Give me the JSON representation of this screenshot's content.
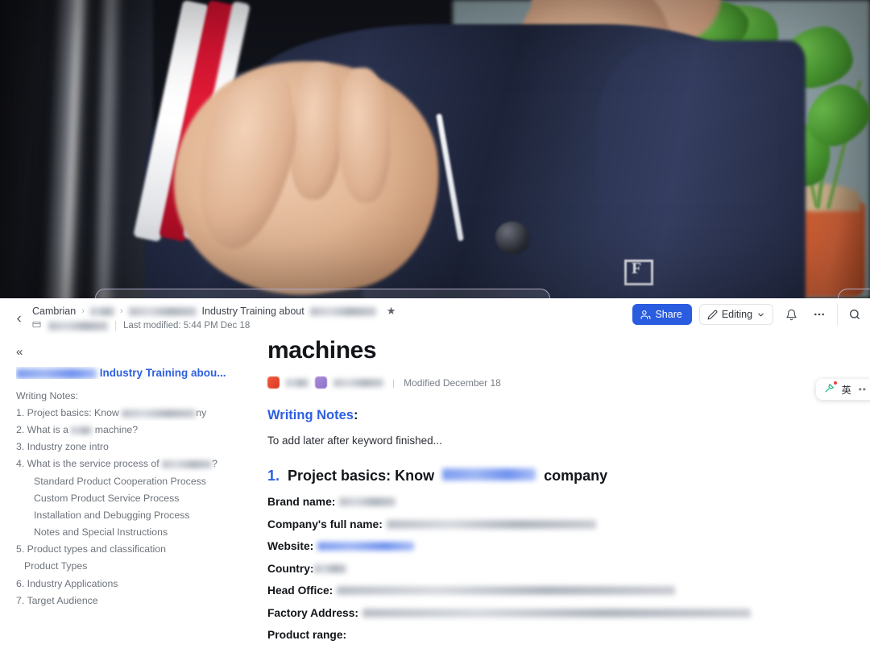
{
  "video": {
    "description": "webcam-video-person-in-navy-jacket",
    "brand_logo": "FILA",
    "window_lip": "rounded-window-edge"
  },
  "topbar": {
    "back_icon": "chevron-left-icon",
    "breadcrumb": {
      "root": "Cambrian",
      "sep": "›",
      "crumb2_redacted": "",
      "crumb3_redacted": "",
      "title_text": "Industry Training about",
      "title_suffix_redacted": "",
      "star_icon": "★"
    },
    "doc_chip_icon": "document-icon",
    "doc_chip_redacted": "",
    "last_modified": "Last modified: 5:44 PM Dec 18",
    "share_label": "Share",
    "share_icon": "people-icon",
    "share_color": "#2a5ce0",
    "editing_label": "Editing",
    "editing_icon": "pencil-icon",
    "editing_caret": "chevron-down-icon",
    "bell_icon": "bell-icon",
    "more_icon": "ellipsis-icon",
    "search_icon": "search-icon",
    "plus_icon": "plus-icon"
  },
  "sidebar": {
    "collapse_icon": "«",
    "outline_title_redacted": "",
    "outline_title": "Industry Training abou...",
    "items": [
      {
        "label": "Writing Notes:",
        "level": 1
      },
      {
        "label": "1. Project basics: Know",
        "level": 1,
        "redacted_tail": "ny"
      },
      {
        "label": "2. What is a",
        "level": 1,
        "redacted_mid": "machine?"
      },
      {
        "label": "3. Industry zone intro",
        "level": 1
      },
      {
        "label": "4. What is the service process of",
        "level": 1,
        "redacted_tail": "?"
      },
      {
        "label": "Standard Product Cooperation Process",
        "level": 2
      },
      {
        "label": "Custom Product Service Process",
        "level": 2
      },
      {
        "label": "Installation and Debugging Process",
        "level": 2
      },
      {
        "label": "Notes and Special Instructions",
        "level": 2
      },
      {
        "label": "5. Product types and classification",
        "level": 1
      },
      {
        "label": "Product Types",
        "level": 1.5
      },
      {
        "label": "6. Industry Applications",
        "level": 1
      },
      {
        "label": "7. Target Audience",
        "level": 1
      }
    ]
  },
  "content": {
    "doc_title": "machines",
    "meta": {
      "author1_redacted": "",
      "author2_redacted": "",
      "modified": "Modified December 18"
    },
    "writing_notes_heading": "Writing Notes",
    "writing_notes_colon": ":",
    "writing_notes_body": "To add later after keyword finished...",
    "section1": {
      "number": "1.",
      "text_before": "Project basics: Know",
      "redacted": "",
      "text_after": "company"
    },
    "fields": [
      {
        "label": "Brand name:",
        "value_redacted": "",
        "value_width": 70,
        "value_type": "gray"
      },
      {
        "label": "Company's full name",
        "label_suffix": ":",
        "value_redacted": "",
        "value_width": 260,
        "value_type": "gray"
      },
      {
        "label": "Website:",
        "value_redacted": "",
        "value_width": 120,
        "value_type": "blue"
      },
      {
        "label": "Country:",
        "value_redacted": "",
        "value_width": 40,
        "value_type": "gray"
      },
      {
        "label": "Head Office:",
        "value_redacted": "",
        "value_width": 420,
        "value_type": "gray"
      },
      {
        "label": "Factory Address:",
        "value_redacted": "",
        "value_width": 480,
        "value_type": "gray"
      },
      {
        "label": "Product range:",
        "value_redacted": null,
        "value_width": 0,
        "value_type": "none"
      }
    ]
  },
  "ime": {
    "pen_icon": "pen-tool-icon",
    "lang": "英",
    "dots_icon": "ellipsis-icon"
  }
}
